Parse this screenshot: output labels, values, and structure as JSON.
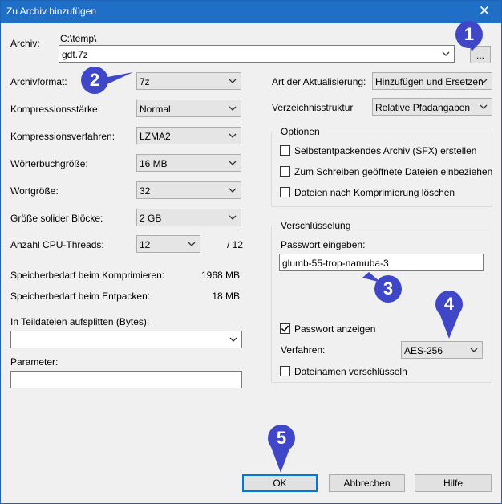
{
  "window": {
    "title": "Zu Archiv hinzufügen"
  },
  "archive": {
    "label": "Archiv:",
    "path": "C:\\temp\\",
    "name": "gdt.7z",
    "browse_label": "..."
  },
  "left": {
    "format": {
      "label": "Archivformat:",
      "value": "7z"
    },
    "level": {
      "label": "Kompressionsstärke:",
      "value": "Normal"
    },
    "method": {
      "label": "Kompressionsverfahren:",
      "value": "LZMA2"
    },
    "dict": {
      "label": "Wörterbuchgröße:",
      "value": "16 MB"
    },
    "word": {
      "label": "Wortgröße:",
      "value": "32"
    },
    "solid": {
      "label": "Größe solider Blöcke:",
      "value": "2 GB"
    },
    "threads": {
      "label": "Anzahl CPU-Threads:",
      "value": "12",
      "max": "/ 12"
    },
    "mem_compress": {
      "label": "Speicherbedarf beim Komprimieren:",
      "value": "1968 MB"
    },
    "mem_decompress": {
      "label": "Speicherbedarf beim Entpacken:",
      "value": "18 MB"
    },
    "split": {
      "label": "In Teildateien aufsplitten (Bytes):",
      "value": ""
    },
    "params": {
      "label": "Parameter:",
      "value": ""
    }
  },
  "right": {
    "update": {
      "label": "Art der Aktualisierung:",
      "value": "Hinzufügen und Ersetzen"
    },
    "paths": {
      "label": "Verzeichnisstruktur",
      "value": "Relative Pfadangaben"
    },
    "options": {
      "legend": "Optionen",
      "sfx": "Selbstentpackendes Archiv (SFX) erstellen",
      "shared": "Zum Schreiben geöffnete Dateien einbeziehen",
      "delete": "Dateien nach Komprimierung löschen"
    },
    "encryption": {
      "legend": "Verschlüsselung",
      "password_label": "Passwort eingeben:",
      "password": "glumb-55-trop-namuba-3",
      "show_password": "Passwort anzeigen",
      "method_label": "Verfahren:",
      "method": "AES-256",
      "encrypt_names": "Dateinamen verschlüsseln"
    }
  },
  "buttons": {
    "ok": "OK",
    "cancel": "Abbrechen",
    "help": "Hilfe"
  },
  "annotations": [
    "1",
    "2",
    "3",
    "4",
    "5"
  ],
  "colors": {
    "badge": "#3f46c8",
    "titlebar": "#1f6fc7",
    "focus": "#0078d7"
  }
}
